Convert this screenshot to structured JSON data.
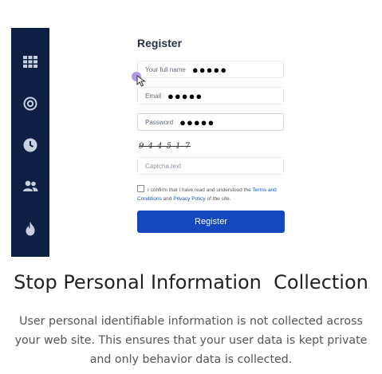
{
  "sidebar": {
    "icons": [
      "grid-icon",
      "target-icon",
      "clock-icon",
      "users-icon",
      "flame-icon"
    ],
    "bg": "#0e1f44",
    "icon_color": "#c7cfe0"
  },
  "form": {
    "title": "Register",
    "full_name": {
      "label": "Your full name",
      "value": "●●●●●"
    },
    "email": {
      "label": "Email",
      "value": "●●●●●"
    },
    "password": {
      "label": "Password",
      "value": "●●●●●"
    },
    "captcha_image_text": "9 4 4 5 1 7",
    "captcha_placeholder": "Captcha text",
    "confirm_pre": "I confirm that I have read and understood the ",
    "terms_link": "Terms and Conditions",
    "confirm_mid": " and ",
    "privacy_link": "Privacy Policy",
    "confirm_post": " of the site.",
    "register_button": "Register",
    "accent": "#1447bd"
  },
  "heading": "Stop Personal Information  Collection",
  "description": "User personal identifiable information is not collected across your web site. This ensures that your user data is kept private and only behavior data is collected."
}
